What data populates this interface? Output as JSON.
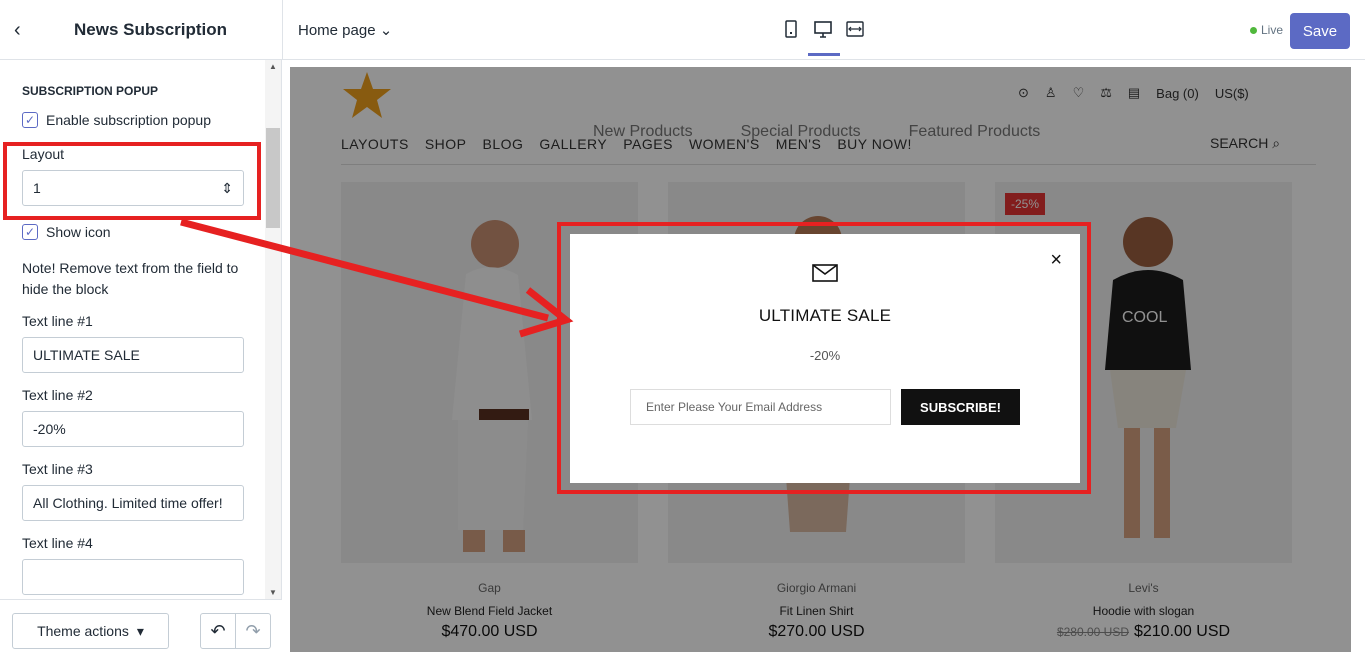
{
  "editor": {
    "panel_title": "News Subscription",
    "page_selector": "Home page",
    "live_label": "Live",
    "save_label": "Save"
  },
  "sidebar": {
    "section_title": "SUBSCRIPTION POPUP",
    "enable_popup_label": "Enable subscription popup",
    "layout_label": "Layout",
    "layout_value": "1",
    "show_icon_label": "Show icon",
    "note": "Note! Remove text from the field to hide the block",
    "fields": [
      {
        "label": "Text line #1",
        "value": "ULTIMATE SALE"
      },
      {
        "label": "Text line #2",
        "value": "-20%"
      },
      {
        "label": "Text line #3",
        "value": "All Clothing. Limited time offer!"
      },
      {
        "label": "Text line #4",
        "value": ""
      }
    ],
    "theme_actions_label": "Theme actions"
  },
  "store": {
    "nav": [
      "LAYOUTS",
      "SHOP",
      "BLOG",
      "GALLERY",
      "PAGES",
      "WOMEN'S",
      "MEN'S",
      "BUY NOW!"
    ],
    "search_label": "SEARCH",
    "bag_label": "Bag (0)",
    "currency_label": "US($)",
    "ghost_tabs": [
      "New Products",
      "Special Products",
      "Featured Products"
    ],
    "products": [
      {
        "brand": "Gap",
        "name": "New Blend Field Jacket",
        "price": "$470.00 USD"
      },
      {
        "brand": "Giorgio Armani",
        "name": "Fit Linen Shirt",
        "price": "$270.00 USD"
      },
      {
        "brand": "Levi's",
        "name": "Hoodie with slogan",
        "old_price": "$280.00 USD",
        "price": "$210.00 USD",
        "badge": "-25%"
      }
    ]
  },
  "popup": {
    "title": "ULTIMATE SALE",
    "subtitle": "-20%",
    "email_placeholder": "Enter Please Your Email Address",
    "subscribe_label": "SUBSCRIBE!"
  },
  "colors": {
    "accent": "#5c6ac4",
    "annotation": "#e62121",
    "live": "#50b83c"
  },
  "icons": [
    "back-chevron-icon",
    "chevron-down-icon",
    "mobile-icon",
    "desktop-icon",
    "full-width-icon",
    "checkbox-icon",
    "select-arrows-icon",
    "undo-icon",
    "redo-icon",
    "star-logo-icon",
    "help-icon",
    "user-icon",
    "heart-icon",
    "compare-icon",
    "bag-icon",
    "search-icon",
    "mail-icon",
    "close-icon"
  ]
}
